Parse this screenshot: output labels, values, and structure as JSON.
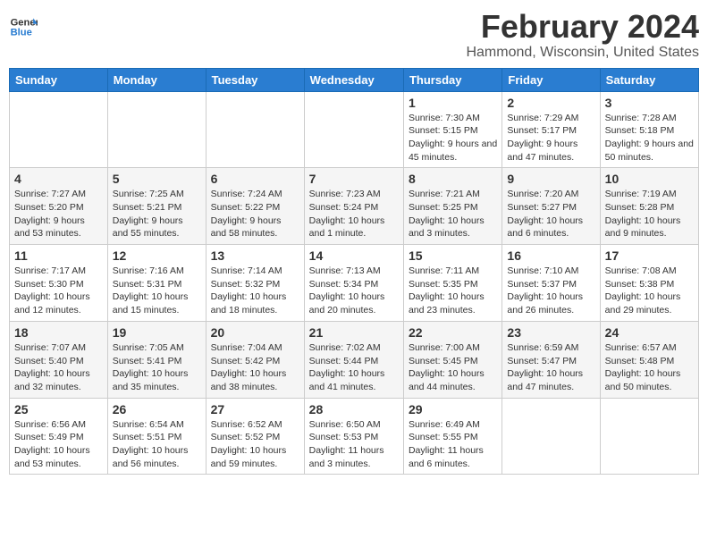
{
  "logo": {
    "line1": "General",
    "line2": "Blue"
  },
  "title": "February 2024",
  "subtitle": "Hammond, Wisconsin, United States",
  "days_header": [
    "Sunday",
    "Monday",
    "Tuesday",
    "Wednesday",
    "Thursday",
    "Friday",
    "Saturday"
  ],
  "weeks": [
    [
      {
        "num": "",
        "info": ""
      },
      {
        "num": "",
        "info": ""
      },
      {
        "num": "",
        "info": ""
      },
      {
        "num": "",
        "info": ""
      },
      {
        "num": "1",
        "info": "Sunrise: 7:30 AM\nSunset: 5:15 PM\nDaylight: 9 hours\nand 45 minutes."
      },
      {
        "num": "2",
        "info": "Sunrise: 7:29 AM\nSunset: 5:17 PM\nDaylight: 9 hours\nand 47 minutes."
      },
      {
        "num": "3",
        "info": "Sunrise: 7:28 AM\nSunset: 5:18 PM\nDaylight: 9 hours\nand 50 minutes."
      }
    ],
    [
      {
        "num": "4",
        "info": "Sunrise: 7:27 AM\nSunset: 5:20 PM\nDaylight: 9 hours\nand 53 minutes."
      },
      {
        "num": "5",
        "info": "Sunrise: 7:25 AM\nSunset: 5:21 PM\nDaylight: 9 hours\nand 55 minutes."
      },
      {
        "num": "6",
        "info": "Sunrise: 7:24 AM\nSunset: 5:22 PM\nDaylight: 9 hours\nand 58 minutes."
      },
      {
        "num": "7",
        "info": "Sunrise: 7:23 AM\nSunset: 5:24 PM\nDaylight: 10 hours\nand 1 minute."
      },
      {
        "num": "8",
        "info": "Sunrise: 7:21 AM\nSunset: 5:25 PM\nDaylight: 10 hours\nand 3 minutes."
      },
      {
        "num": "9",
        "info": "Sunrise: 7:20 AM\nSunset: 5:27 PM\nDaylight: 10 hours\nand 6 minutes."
      },
      {
        "num": "10",
        "info": "Sunrise: 7:19 AM\nSunset: 5:28 PM\nDaylight: 10 hours\nand 9 minutes."
      }
    ],
    [
      {
        "num": "11",
        "info": "Sunrise: 7:17 AM\nSunset: 5:30 PM\nDaylight: 10 hours\nand 12 minutes."
      },
      {
        "num": "12",
        "info": "Sunrise: 7:16 AM\nSunset: 5:31 PM\nDaylight: 10 hours\nand 15 minutes."
      },
      {
        "num": "13",
        "info": "Sunrise: 7:14 AM\nSunset: 5:32 PM\nDaylight: 10 hours\nand 18 minutes."
      },
      {
        "num": "14",
        "info": "Sunrise: 7:13 AM\nSunset: 5:34 PM\nDaylight: 10 hours\nand 20 minutes."
      },
      {
        "num": "15",
        "info": "Sunrise: 7:11 AM\nSunset: 5:35 PM\nDaylight: 10 hours\nand 23 minutes."
      },
      {
        "num": "16",
        "info": "Sunrise: 7:10 AM\nSunset: 5:37 PM\nDaylight: 10 hours\nand 26 minutes."
      },
      {
        "num": "17",
        "info": "Sunrise: 7:08 AM\nSunset: 5:38 PM\nDaylight: 10 hours\nand 29 minutes."
      }
    ],
    [
      {
        "num": "18",
        "info": "Sunrise: 7:07 AM\nSunset: 5:40 PM\nDaylight: 10 hours\nand 32 minutes."
      },
      {
        "num": "19",
        "info": "Sunrise: 7:05 AM\nSunset: 5:41 PM\nDaylight: 10 hours\nand 35 minutes."
      },
      {
        "num": "20",
        "info": "Sunrise: 7:04 AM\nSunset: 5:42 PM\nDaylight: 10 hours\nand 38 minutes."
      },
      {
        "num": "21",
        "info": "Sunrise: 7:02 AM\nSunset: 5:44 PM\nDaylight: 10 hours\nand 41 minutes."
      },
      {
        "num": "22",
        "info": "Sunrise: 7:00 AM\nSunset: 5:45 PM\nDaylight: 10 hours\nand 44 minutes."
      },
      {
        "num": "23",
        "info": "Sunrise: 6:59 AM\nSunset: 5:47 PM\nDaylight: 10 hours\nand 47 minutes."
      },
      {
        "num": "24",
        "info": "Sunrise: 6:57 AM\nSunset: 5:48 PM\nDaylight: 10 hours\nand 50 minutes."
      }
    ],
    [
      {
        "num": "25",
        "info": "Sunrise: 6:56 AM\nSunset: 5:49 PM\nDaylight: 10 hours\nand 53 minutes."
      },
      {
        "num": "26",
        "info": "Sunrise: 6:54 AM\nSunset: 5:51 PM\nDaylight: 10 hours\nand 56 minutes."
      },
      {
        "num": "27",
        "info": "Sunrise: 6:52 AM\nSunset: 5:52 PM\nDaylight: 10 hours\nand 59 minutes."
      },
      {
        "num": "28",
        "info": "Sunrise: 6:50 AM\nSunset: 5:53 PM\nDaylight: 11 hours\nand 3 minutes."
      },
      {
        "num": "29",
        "info": "Sunrise: 6:49 AM\nSunset: 5:55 PM\nDaylight: 11 hours\nand 6 minutes."
      },
      {
        "num": "",
        "info": ""
      },
      {
        "num": "",
        "info": ""
      }
    ]
  ]
}
